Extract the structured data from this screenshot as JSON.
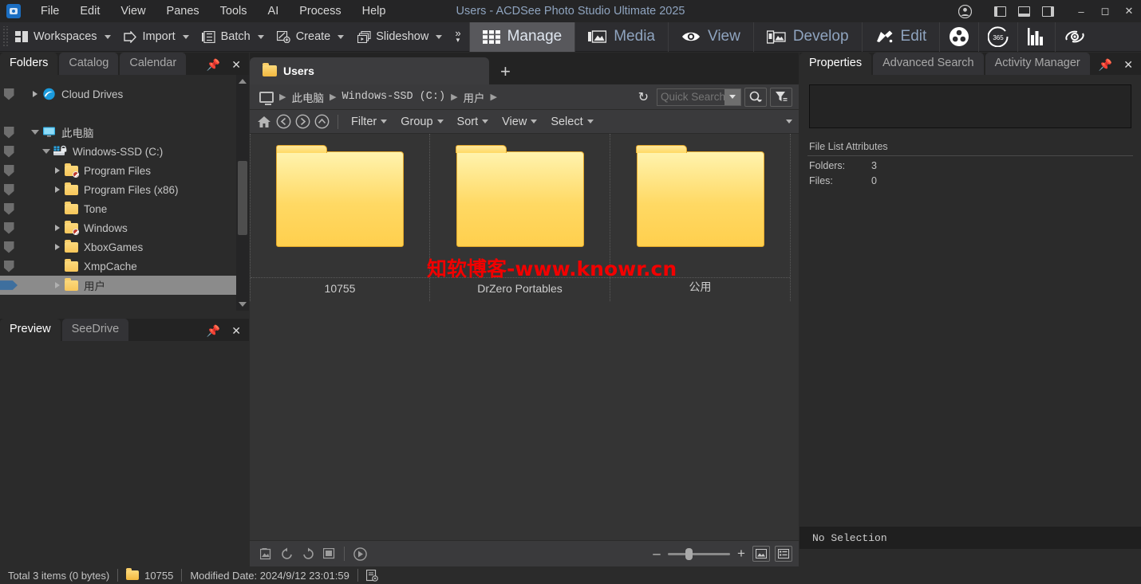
{
  "window": {
    "title": "Users - ACDSee Photo Studio Ultimate 2025",
    "app_icon": "camera-app-icon",
    "minimize": "–",
    "maximize": "◻",
    "close": "✕",
    "account_icon": "account-icon",
    "layout_left_icon": "layout-left-pane-icon",
    "layout_bottom_icon": "layout-bottom-pane-icon",
    "layout_right_icon": "layout-right-pane-icon"
  },
  "menubar": {
    "items": [
      "File",
      "Edit",
      "View",
      "Panes",
      "Tools",
      "AI",
      "Process",
      "Help"
    ]
  },
  "toolbar": {
    "buttons": [
      {
        "label": "Workspaces",
        "icon": "workspaces-icon",
        "has_caret": true
      },
      {
        "label": "Import",
        "icon": "import-icon",
        "has_caret": true
      },
      {
        "label": "Batch",
        "icon": "batch-icon",
        "has_caret": true
      },
      {
        "label": "Create",
        "icon": "create-icon",
        "has_caret": true
      },
      {
        "label": "Slideshow",
        "icon": "slideshow-icon",
        "has_caret": true
      }
    ],
    "overflow": "»"
  },
  "modes": {
    "items": [
      {
        "label": "Manage",
        "icon": "grid-icon",
        "active": true
      },
      {
        "label": "Media",
        "icon": "media-icon",
        "active": false
      },
      {
        "label": "View",
        "icon": "eye-icon",
        "active": false
      },
      {
        "label": "Develop",
        "icon": "develop-icon",
        "active": false
      },
      {
        "label": "Edit",
        "icon": "edit-brush-icon",
        "active": false
      }
    ],
    "icon_only": [
      {
        "icon": "people-icon",
        "label": ""
      },
      {
        "icon": "365-icon",
        "label": "365"
      },
      {
        "icon": "bar-chart-icon",
        "label": ""
      },
      {
        "icon": "photo-recovery-icon",
        "label": ""
      }
    ]
  },
  "left_panel": {
    "tabs": [
      {
        "label": "Folders",
        "active": true
      },
      {
        "label": "Catalog",
        "active": false
      },
      {
        "label": "Calendar",
        "active": false
      }
    ],
    "pin_icon": "pin-icon",
    "close_icon": "close-icon",
    "tree": [
      {
        "label": "Cloud Drives",
        "indent": 1,
        "expander": "collapsed",
        "icon": "cloud-drive-icon",
        "selected": false,
        "blocked": false
      },
      {
        "label": "",
        "indent": 0,
        "expander": "none",
        "icon": "spacer",
        "selected": false,
        "blocked": false,
        "spacer": true
      },
      {
        "label": "此电脑",
        "indent": 1,
        "expander": "expanded",
        "icon": "computer-icon",
        "selected": false,
        "blocked": false
      },
      {
        "label": "Windows-SSD (C:)",
        "indent": 2,
        "expander": "expanded",
        "icon": "drive-icon",
        "selected": false,
        "blocked": false
      },
      {
        "label": "Program Files",
        "indent": 3,
        "expander": "collapsed",
        "icon": "folder-icon",
        "selected": false,
        "blocked": true
      },
      {
        "label": "Program Files (x86)",
        "indent": 3,
        "expander": "collapsed",
        "icon": "folder-icon",
        "selected": false,
        "blocked": false
      },
      {
        "label": "Tone",
        "indent": 3,
        "expander": "none",
        "icon": "folder-icon",
        "selected": false,
        "blocked": false
      },
      {
        "label": "Windows",
        "indent": 3,
        "expander": "collapsed",
        "icon": "folder-icon",
        "selected": false,
        "blocked": true
      },
      {
        "label": "XboxGames",
        "indent": 3,
        "expander": "collapsed",
        "icon": "folder-icon",
        "selected": false,
        "blocked": false
      },
      {
        "label": "XmpCache",
        "indent": 3,
        "expander": "none",
        "icon": "folder-icon",
        "selected": false,
        "blocked": false
      },
      {
        "label": "用户",
        "indent": 3,
        "expander": "collapsed",
        "icon": "folder-icon",
        "selected": true,
        "blocked": false
      }
    ],
    "preview_tabs": [
      {
        "label": "Preview",
        "active": true
      },
      {
        "label": "SeeDrive",
        "active": false
      }
    ]
  },
  "center": {
    "file_tab": {
      "label": "Users",
      "icon": "folder-icon"
    },
    "new_tab_label": "+",
    "breadcrumb": {
      "root_icon": "monitor-icon",
      "parts": [
        "此电脑",
        "Windows-SSD (C:)",
        "用户"
      ],
      "separator": "▶"
    },
    "refresh_icon": "refresh-icon",
    "search": {
      "placeholder": "Quick Search",
      "value": "",
      "dropdown_icon": "chevron-down-icon"
    },
    "search_button_icon": "search-icon",
    "filter_button_icon": "filter-funnel-icon",
    "filterbar": {
      "nav_icons": [
        "home-icon",
        "back-icon",
        "forward-icon",
        "up-icon"
      ],
      "menus": [
        "Filter",
        "Group",
        "Sort",
        "View",
        "Select"
      ],
      "overflow_icon": "chevron-down-icon"
    },
    "items": [
      {
        "name": "10755",
        "type": "folder"
      },
      {
        "name": "DrZero Portables",
        "type": "folder"
      },
      {
        "name": "公用",
        "type": "folder"
      }
    ],
    "watermark": "知软博客-www.knowr.cn",
    "bottom_toolbar": {
      "icons": [
        "thumbnail-icon",
        "rotate-left-icon",
        "rotate-right-icon",
        "stop-icon",
        "play-slideshow-icon"
      ],
      "zoom_minus": "–",
      "zoom_plus": "+",
      "view_icons": [
        "thumbnail-view-icon",
        "detail-view-icon"
      ]
    }
  },
  "right_panel": {
    "tabs": [
      {
        "label": "Properties",
        "active": true
      },
      {
        "label": "Advanced Search",
        "active": false
      },
      {
        "label": "Activity Manager",
        "active": false
      }
    ],
    "pin_icon": "pin-icon",
    "close_icon": "close-icon",
    "section_title": "File List Attributes",
    "attributes": [
      {
        "key": "Folders:",
        "value": "3"
      },
      {
        "key": "Files:",
        "value": "0"
      }
    ],
    "selection_status": "No Selection"
  },
  "statusbar": {
    "total": "Total 3 items  (0 bytes)",
    "current_item": "10755",
    "modified": "Modified Date: 2024/9/12 23:01:59",
    "settings_icon": "list-settings-icon"
  },
  "colors": {
    "accent_blue": "#8fa4bf",
    "folder_yellow": "#ffd964",
    "watermark_red": "#f20000",
    "selected_row": "#8b8b8b"
  }
}
